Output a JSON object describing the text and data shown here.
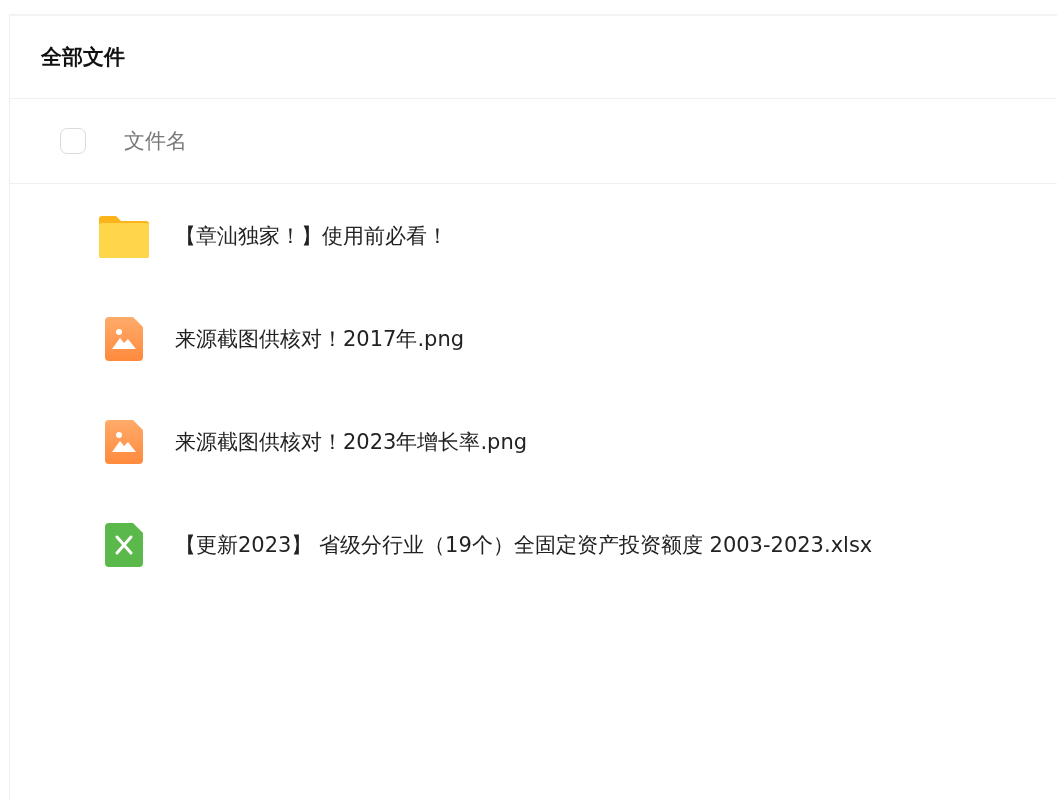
{
  "title": "全部文件",
  "header": {
    "checked": false,
    "column": "文件名"
  },
  "files": [
    {
      "kind": "folder",
      "name": "【章汕独家！】使用前必看！"
    },
    {
      "kind": "image",
      "name": "来源截图供核对！2017年.png"
    },
    {
      "kind": "image",
      "name": "来源截图供核对！2023年增长率.png"
    },
    {
      "kind": "sheet",
      "name": "【更新2023】 省级分行业（19个）全固定资产投资额度 2003-2023.xlsx"
    }
  ]
}
